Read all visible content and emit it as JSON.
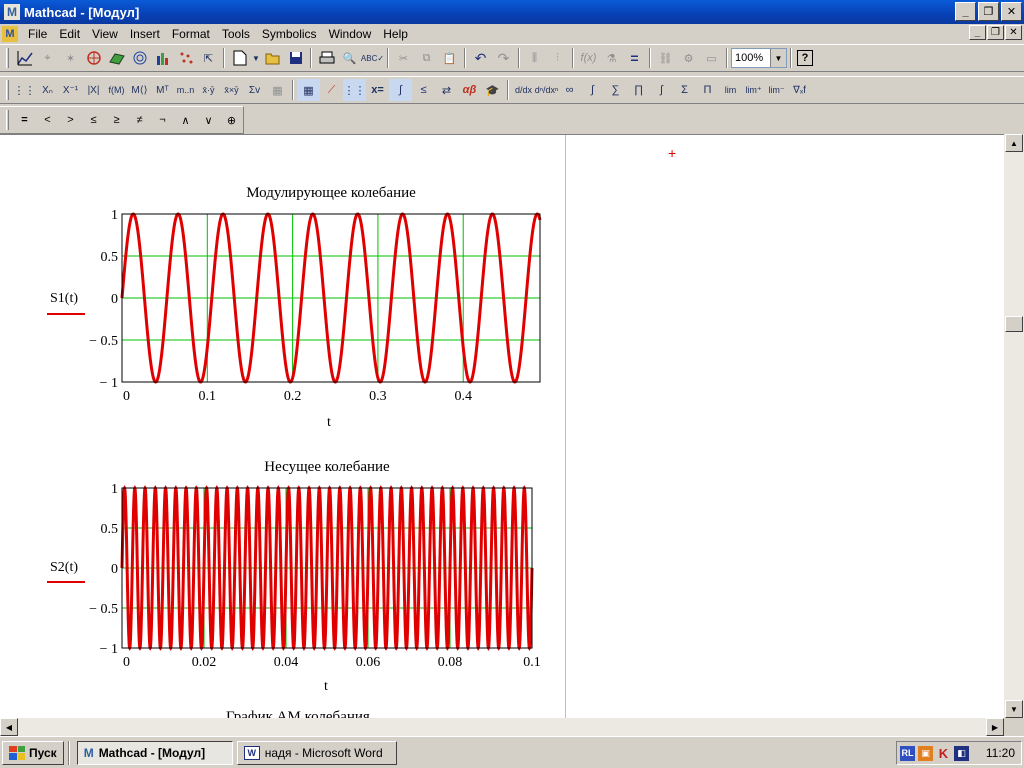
{
  "window": {
    "app_icon": "mathcad-icon",
    "title": "Mathcad - [Модул]",
    "buttons": [
      "_",
      "❐",
      "✕"
    ]
  },
  "menubar": {
    "items": [
      "File",
      "Edit",
      "View",
      "Insert",
      "Format",
      "Tools",
      "Symbolics",
      "Window",
      "Help"
    ]
  },
  "toolbar_standard": {
    "zoom": "100%",
    "help_label": "?"
  },
  "toolbar_math": {
    "buttons": [
      "x=",
      "αβ",
      "∫",
      "∑",
      "∏",
      "lim",
      "∞"
    ]
  },
  "toolbar_boolean": {
    "buttons": [
      "=",
      "<",
      ">",
      "≤",
      "≥",
      "≠",
      "¬",
      "∧",
      "∨",
      "⊕"
    ]
  },
  "colors": {
    "trace": "#e00000",
    "grid": "#00c000",
    "titlebar": "#0a5bd8"
  },
  "plots": [
    {
      "title": "Модулирующее колебание",
      "y_label": "S1(t)",
      "x_label": "t",
      "x_ticks": [
        "0",
        "0.1",
        "0.2",
        "0.3",
        "0.4"
      ],
      "y_ticks": [
        "1",
        "0.5",
        "0",
        "− 0.5",
        "− 1"
      ]
    },
    {
      "title": "Несущее колебание",
      "y_label": "S2(t)",
      "x_label": "t",
      "x_ticks": [
        "0",
        "0.02",
        "0.04",
        "0.06",
        "0.08",
        "0.1"
      ],
      "y_ticks": [
        "1",
        "0.5",
        "0",
        "− 0.5",
        "− 1"
      ]
    }
  ],
  "partial_text": "График АМ колебания",
  "chart_data": [
    {
      "type": "line",
      "title": "Модулирующее колебание",
      "xlabel": "t",
      "ylabel": "S1(t)",
      "xlim": [
        0,
        0.49
      ],
      "ylim": [
        -1,
        1
      ],
      "function": "sin(2*pi*19*t)",
      "frequency_hz": 19,
      "x_ticks": [
        0,
        0.1,
        0.2,
        0.3,
        0.4
      ],
      "y_ticks": [
        -1,
        -0.5,
        0,
        0.5,
        1
      ],
      "grid": true
    },
    {
      "type": "line",
      "title": "Несущее колебание",
      "xlabel": "t",
      "ylabel": "S2(t)",
      "xlim": [
        0,
        0.1
      ],
      "ylim": [
        -1,
        1
      ],
      "function": "sin(2*pi*400*t)",
      "frequency_hz": 400,
      "x_ticks": [
        0,
        0.02,
        0.04,
        0.06,
        0.08,
        0.1
      ],
      "y_ticks": [
        -1,
        -0.5,
        0,
        0.5,
        1
      ],
      "grid": true
    }
  ],
  "taskbar": {
    "start_label": "Пуск",
    "tasks": [
      {
        "label": "Mathcad - [Модул]",
        "icon": "mathcad-icon",
        "active": true
      },
      {
        "label": "надя - Microsoft Word",
        "icon": "word-icon",
        "active": false
      }
    ],
    "tray": {
      "lang": "RL",
      "clock": "11:20"
    }
  }
}
